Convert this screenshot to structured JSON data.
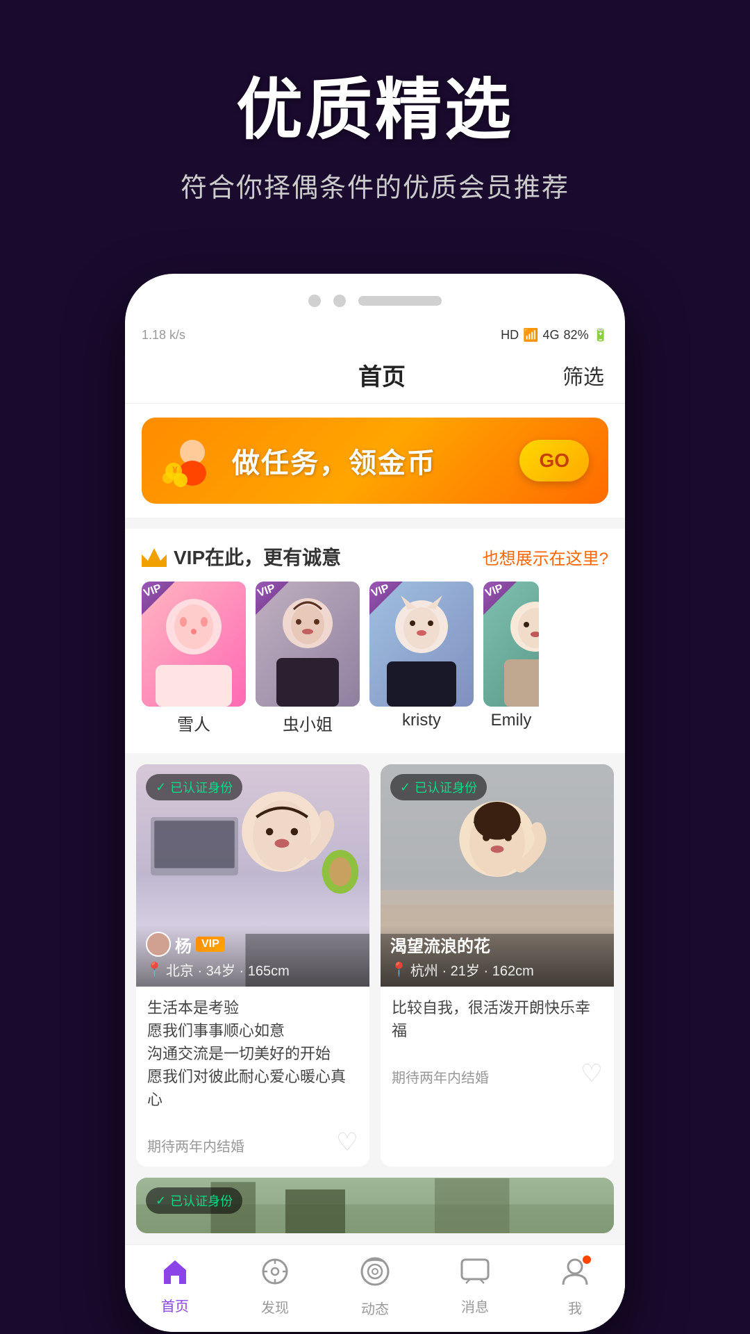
{
  "hero": {
    "title": "优质精选",
    "subtitle": "符合你择偶条件的优质会员推荐"
  },
  "status_bar": {
    "speed": "1.18 k/s",
    "hd": "HD",
    "signal": "4G",
    "battery": "82%"
  },
  "nav": {
    "title": "首页",
    "filter": "筛选"
  },
  "banner": {
    "text": "做任务，领金币",
    "button": "GO"
  },
  "vip_section": {
    "title": "VIP在此，更有诚意",
    "link": "也想展示在这里?",
    "members": [
      {
        "name": "雪人",
        "id": "vip1"
      },
      {
        "name": "虫小姐",
        "id": "vip2"
      },
      {
        "name": "kristy",
        "id": "vip3"
      },
      {
        "name": "Emily",
        "id": "vip4"
      }
    ]
  },
  "user_cards": [
    {
      "id": "user1",
      "name": "杨",
      "full_name": "杨",
      "verified": "已认证身份",
      "location": "北京",
      "age": "34岁",
      "height": "165cm",
      "bio": "生活本是考验\n愿我们事事顺心如意\n沟通交流是一切美好的开始\n愿我们对彼此耐心爱心暖心真心",
      "expectation": "期待两年内结婚",
      "vip": true
    },
    {
      "id": "user2",
      "name": "渴望流浪的花",
      "verified": "已认证身份",
      "location": "杭州",
      "age": "21岁",
      "height": "162cm",
      "bio": "比较自我，很活泼开朗快乐幸福",
      "expectation": "期待两年内结婚",
      "vip": false
    },
    {
      "id": "user3",
      "name": "...",
      "verified": "已认证身份",
      "location": "...",
      "age": "...",
      "height": "...",
      "bio": "",
      "expectation": "",
      "vip": false
    }
  ],
  "bottom_nav": {
    "items": [
      {
        "label": "首页",
        "active": true
      },
      {
        "label": "发现",
        "active": false
      },
      {
        "label": "动态",
        "active": false
      },
      {
        "label": "消息",
        "active": false
      },
      {
        "label": "我",
        "active": false
      }
    ]
  }
}
